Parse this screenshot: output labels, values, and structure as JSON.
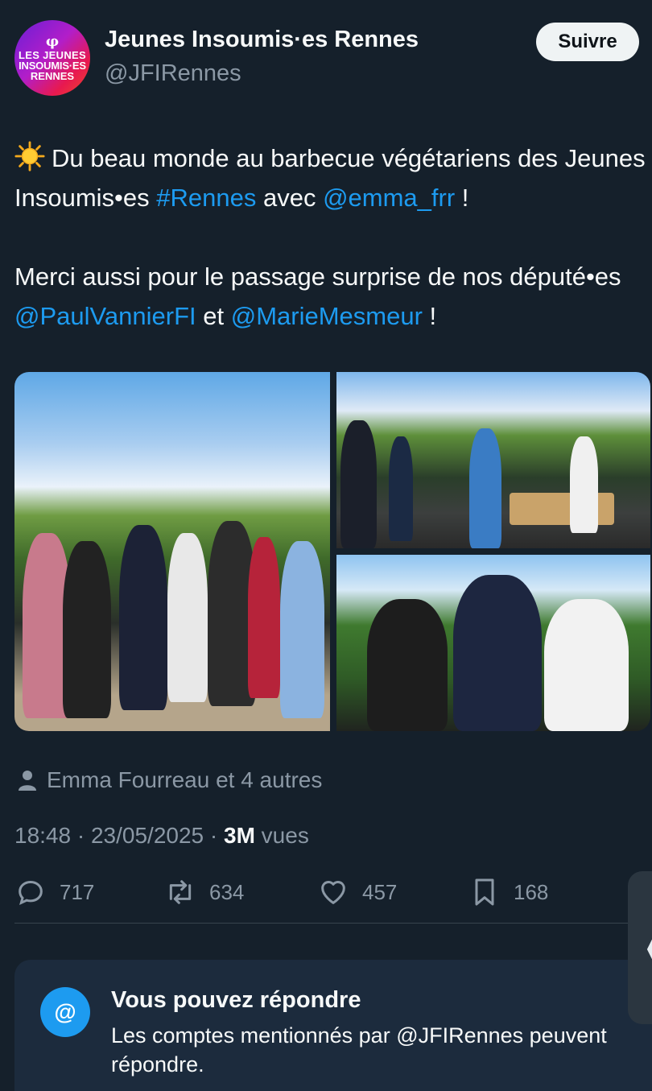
{
  "account": {
    "name": "Jeunes Insoumis·es Rennes",
    "handle": "@JFIRennes",
    "avatar_phi": "φ",
    "avatar_line1": "LES JEUNES",
    "avatar_line2": "INSOUMIS·ES",
    "avatar_line3": "RENNES"
  },
  "follow_label": "Suivre",
  "tweet": {
    "line1_text": "Du beau monde au barbecue végétariens des Jeunes Insoumis•es ",
    "line1_hashtag": "#Rennes",
    "line1_mid": " avec ",
    "line1_mention": "@emma_frr",
    "line1_end": " !",
    "line2_text": "Merci aussi pour le passage surprise de nos député•es ",
    "line2_mention1": "@PaulVannierFI",
    "line2_mid": " et ",
    "line2_mention2": "@MarieMesmeur",
    "line2_end": " !"
  },
  "likers": "Emma Fourreau et 4 autres",
  "meta": {
    "time": "18:48",
    "date": "23/05/2025",
    "sep": " · ",
    "views": "3M",
    "views_label": " vues"
  },
  "actions": {
    "replies": "717",
    "retweets": "634",
    "likes": "457",
    "bookmarks": "168"
  },
  "reply_card": {
    "icon": "@",
    "title": "Vous pouvez répondre",
    "description": "Les comptes mentionnés par @JFIRennes peuvent répondre."
  },
  "side_handle_glyph": "❬"
}
